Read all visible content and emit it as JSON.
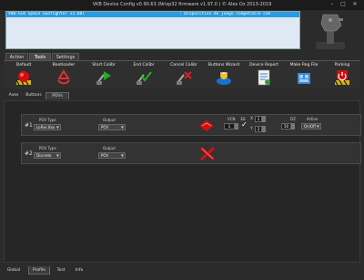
{
  "window": {
    "title": "VKB Device Config v0.90.63 (Nrisp32 firmware v1.97.0 ) © Alex Oz 2013-2019",
    "min_glyph": "–",
    "max_glyph": "□",
    "close_glyph": "✕"
  },
  "device_display": {
    "name": "VKB-Sim Space Gunfighter  v1.88l",
    "status": ": Dispositivo de juego compatible con"
  },
  "top_tabs": [
    "Action",
    "Tools",
    "Settings"
  ],
  "top_tabs_active": "Tools",
  "toolbar": [
    {
      "label": "Default",
      "icon": "default-red-circle-icon"
    },
    {
      "label": "Bootloader",
      "icon": "bootloader-recycle-icon"
    },
    {
      "label": "Start Calibr",
      "icon": "start-calibrate-icon"
    },
    {
      "label": "End Calibr",
      "icon": "end-calibrate-icon"
    },
    {
      "label": "Cancel Calibr",
      "icon": "cancel-calibrate-icon"
    },
    {
      "label": "Buttons Wizard",
      "icon": "buttons-wizard-icon"
    },
    {
      "label": "Device Report",
      "icon": "device-report-icon"
    },
    {
      "label": "Make Reg File",
      "icon": "make-reg-file-icon"
    },
    {
      "label": "Parking",
      "icon": "parking-power-icon"
    }
  ],
  "sub_tabs": [
    "Axes",
    "Buttons",
    "POVs"
  ],
  "sub_tabs_active": "POVs",
  "pov_rows": [
    {
      "index": "#1",
      "pov_type_label": "POV Type",
      "pov_type_value": "LoRes 8xx",
      "output_label": "Output",
      "output_value": "POV",
      "vcn_label": "VCN",
      "vcn_value": "1",
      "vcn_check": "✓",
      "switch_label": "3D",
      "x_label": "X",
      "y_label": "Y",
      "x_value": "1",
      "y_value": "2",
      "dz_label": "DZ",
      "dz_value": "50",
      "active_label": "Active",
      "active_value": "On/Off",
      "state": "active"
    },
    {
      "index": "#2",
      "pov_type_label": "POV Type",
      "pov_type_value": "Discrete",
      "output_label": "Output",
      "output_value": "POV",
      "state": "removed"
    }
  ],
  "bottom_tabs": [
    "Global",
    "Profile",
    "Test",
    "Info"
  ],
  "bottom_tabs_active": "Profile",
  "colors": {
    "lcd_bar": "#2a9be0",
    "lcd_bg": "#dfe9f3",
    "accent_red": "#d01010"
  }
}
